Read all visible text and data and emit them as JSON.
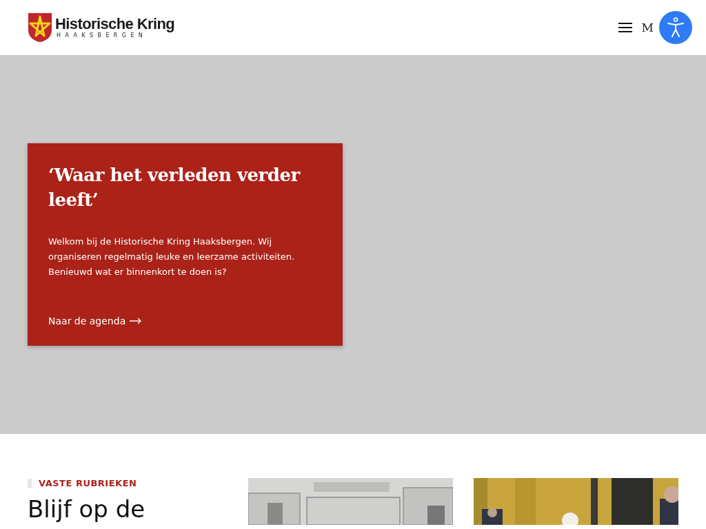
{
  "header": {
    "logo_title": "Historische Kring",
    "logo_subtitle": "HAAKSBERGEN",
    "menu_label": "M"
  },
  "hero": {
    "title": "‘Waar het verleden verder leeft’",
    "text": "Welkom bij de Historische Kring Haaksbergen. Wij organiseren regelmatig leuke en leerzame activiteiten. Benieuwd wat er binnenkort te doen is?",
    "link": "Naar de agenda"
  },
  "section": {
    "eyebrow": "VASTE RUBRIEKEN",
    "heading": "Blijf op de"
  }
}
